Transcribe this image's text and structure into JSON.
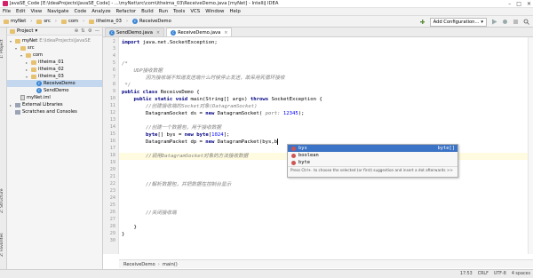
{
  "window": {
    "title": "JavaSE_Code [E:\\IdeaProjects\\JavaSE_Code] - ...\\myNet\\src\\com\\itheima_03\\ReceiveDemo.java [myNet] - IntelliJ IDEA",
    "controls": [
      "–",
      "□",
      "✕"
    ]
  },
  "menu": [
    "File",
    "Edit",
    "View",
    "Navigate",
    "Code",
    "Analyze",
    "Refactor",
    "Build",
    "Run",
    "Tools",
    "VCS",
    "Window",
    "Help"
  ],
  "navbar": {
    "crumbs": [
      "myNet",
      "src",
      "com",
      "itheima_03",
      "ReceiveDemo"
    ],
    "add_config": "Add Configuration..."
  },
  "sidebar": {
    "tabs": [
      "1: Project",
      "Z: Structure",
      "2: Favorites"
    ]
  },
  "project": {
    "header": "Project",
    "items": [
      {
        "label": "myNet",
        "extra": "E:\\IdeaProjects\\JavaSE",
        "arrow": "▾",
        "indent": 0,
        "icon": "folder"
      },
      {
        "label": "src",
        "extra": "",
        "arrow": "▾",
        "indent": 1,
        "icon": "folder"
      },
      {
        "label": "com",
        "extra": "",
        "arrow": "▾",
        "indent": 2,
        "icon": "folder"
      },
      {
        "label": "itheima_01",
        "extra": "",
        "arrow": "▸",
        "indent": 3,
        "icon": "folder"
      },
      {
        "label": "itheima_02",
        "extra": "",
        "arrow": "▸",
        "indent": 3,
        "icon": "folder"
      },
      {
        "label": "itheima_03",
        "extra": "",
        "arrow": "▾",
        "indent": 3,
        "icon": "folder"
      },
      {
        "label": "ReceiveDemo",
        "extra": "",
        "arrow": "",
        "indent": 4,
        "icon": "class",
        "selected": true
      },
      {
        "label": "SendDemo",
        "extra": "",
        "arrow": "",
        "indent": 4,
        "icon": "class"
      },
      {
        "label": "myNet.iml",
        "extra": "",
        "arrow": "",
        "indent": 1,
        "icon": "iml"
      },
      {
        "label": "External Libraries",
        "extra": "",
        "arrow": "▸",
        "indent": 0,
        "icon": "lib"
      },
      {
        "label": "Scratches and Consoles",
        "extra": "",
        "arrow": "",
        "indent": 0,
        "icon": "lib"
      }
    ]
  },
  "tabs": [
    {
      "label": "SendDemo.java",
      "active": false
    },
    {
      "label": "ReceiveDemo.java",
      "active": true
    }
  ],
  "editor": {
    "line_numbers": [
      "2",
      "3",
      "4",
      "5",
      "6",
      "7",
      "8",
      "9",
      "10",
      "11",
      "12",
      "13",
      "14",
      "15",
      "16",
      "17",
      "18",
      "19",
      "20",
      "21",
      "22",
      "23",
      "24",
      "25",
      "26",
      "27",
      "28",
      "29",
      "30"
    ],
    "current_line_index": 16,
    "lines": [
      {
        "t": "import java.net.SocketException;",
        "k": "import"
      },
      {
        "t": "",
        "k": "blank"
      },
      {
        "t": "",
        "k": "blank"
      },
      {
        "t": "/*",
        "k": "comment"
      },
      {
        "t": "    UDP接收数据",
        "k": "comment"
      },
      {
        "t": "        因为接收端不知道发送端什么时候停止发送，故采用死循环接收",
        "k": "comment"
      },
      {
        "t": " */",
        "k": "comment"
      },
      {
        "t": "public class ReceiveDemo {",
        "k": "class"
      },
      {
        "t": "    public static void main(String[] args) throws SocketException {",
        "k": "main"
      },
      {
        "t": "        //创建接收端的Socket对象(DatagramSocket)",
        "k": "comment"
      },
      {
        "t": "        DatagramSocket ds = new DatagramSocket( port: 12345);",
        "k": "ds"
      },
      {
        "t": "",
        "k": "blank"
      },
      {
        "t": "        //创建一个数据包，用于接收数据",
        "k": "comment"
      },
      {
        "t": "        byte[] bys = new byte[1024];",
        "k": "bys"
      },
      {
        "t": "        DatagramPacket dp = new DatagramPacket(bys,b",
        "k": "dp"
      },
      {
        "t": "",
        "k": "blank"
      },
      {
        "t": "        //调用DatagramSocket对象的方法接收数据",
        "k": "comment"
      },
      {
        "t": "",
        "k": "blank"
      },
      {
        "t": "",
        "k": "blank"
      },
      {
        "t": "",
        "k": "blank"
      },
      {
        "t": "        //解析数据包，并把数据在控制台显示",
        "k": "comment"
      },
      {
        "t": "",
        "k": "blank"
      },
      {
        "t": "",
        "k": "blank"
      },
      {
        "t": "",
        "k": "blank"
      },
      {
        "t": "        //关闭接收端",
        "k": "comment"
      },
      {
        "t": "",
        "k": "blank"
      },
      {
        "t": "    }",
        "k": "plain"
      },
      {
        "t": "}",
        "k": "plain"
      },
      {
        "t": "",
        "k": "blank"
      }
    ]
  },
  "completion": {
    "items": [
      {
        "name": "bys",
        "type": "byte[]",
        "selected": true
      },
      {
        "name": "boolean",
        "type": "",
        "selected": false
      },
      {
        "name": "byte",
        "type": "",
        "selected": false
      }
    ],
    "footer": "Press Ctrl+. to choose the selected (or first) suggestion and insert a dot afterwards >>"
  },
  "editor_breadcrumb": [
    "ReceiveDemo",
    "main()"
  ],
  "status": {
    "left": "",
    "right": [
      "17:53",
      "CRLF",
      "UTF-8",
      "4 spaces"
    ]
  }
}
